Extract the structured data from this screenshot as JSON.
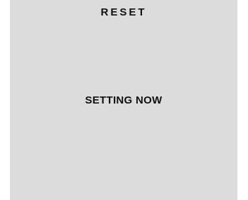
{
  "screen": {
    "title": "RESET",
    "status": "SETTING NOW"
  },
  "colors": {
    "panel_background": "#dcdcdc",
    "text": "#111111",
    "page_background": "#ffffff"
  }
}
